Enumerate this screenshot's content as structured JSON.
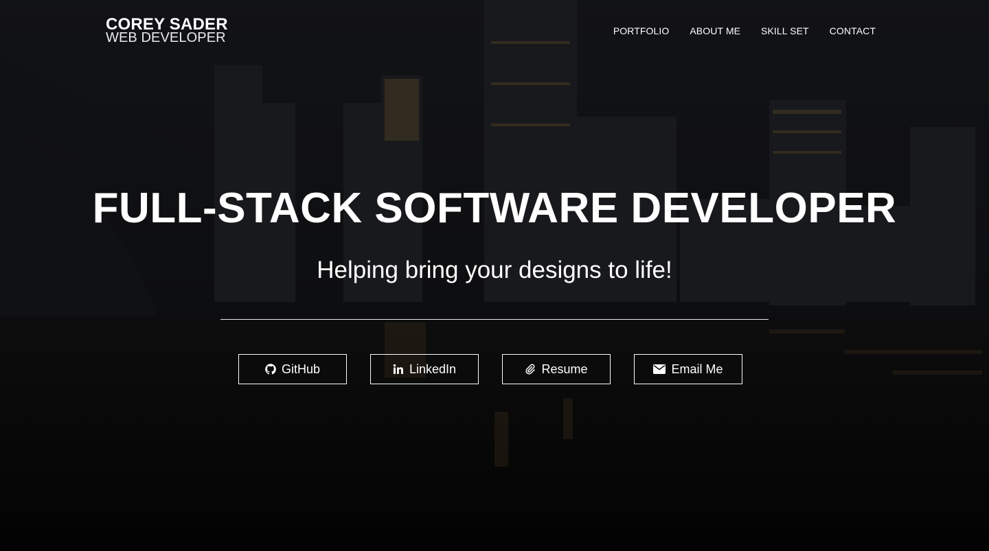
{
  "brand": {
    "name": "COREY SADER",
    "subtitle": "WEB DEVELOPER"
  },
  "nav": {
    "items": [
      {
        "label": "PORTFOLIO"
      },
      {
        "label": "ABOUT ME"
      },
      {
        "label": "SKILL SET"
      },
      {
        "label": "CONTACT"
      }
    ]
  },
  "hero": {
    "title": "FULL-STACK SOFTWARE DEVELOPER",
    "subtitle": "Helping bring your designs to life!"
  },
  "buttons": [
    {
      "label": "GitHub",
      "icon": "github-icon"
    },
    {
      "label": "LinkedIn",
      "icon": "linkedin-icon"
    },
    {
      "label": "Resume",
      "icon": "paperclip-icon"
    },
    {
      "label": "Email Me",
      "icon": "envelope-icon"
    }
  ],
  "colors": {
    "text": "#ffffff",
    "background": "#111215"
  }
}
